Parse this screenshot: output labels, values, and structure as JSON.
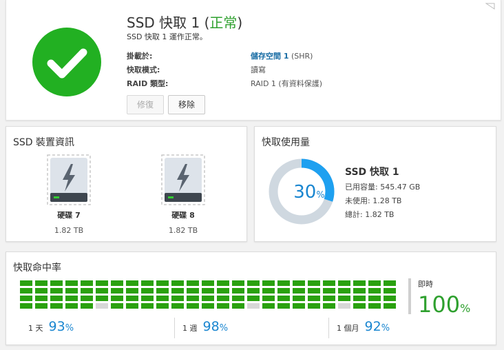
{
  "header": {
    "title_prefix": "SSD 快取 1 (",
    "title_status": "正常",
    "title_suffix": ")",
    "subtitle": "SSD 快取 1 運作正常。",
    "status_color": "#22b022"
  },
  "info": {
    "mount_label": "掛載於:",
    "mount_value_bold": "儲存空間 1",
    "mount_value_rest": " (SHR)",
    "mode_label": "快取模式:",
    "mode_value": "讀寫",
    "raid_label": "RAID 類型:",
    "raid_value": "RAID 1 (有資料保護)"
  },
  "buttons": {
    "repair": "修復",
    "remove": "移除"
  },
  "device_info": {
    "title": "SSD 裝置資訊",
    "drives": [
      {
        "name": "硬碟 7",
        "size": "1.82 TB"
      },
      {
        "name": "硬碟 8",
        "size": "1.82 TB"
      }
    ]
  },
  "cache_usage": {
    "title": "快取使用量",
    "percent": "30",
    "percent_sign": "%",
    "percent_value": 30,
    "cache_name": "SSD 快取 1",
    "used": "已用容量: 545.47 GB",
    "unused": "未使用: 1.28 TB",
    "total": "總計: 1.82 TB",
    "ring_color": "#1ea0f0",
    "ring_bg_color": "#cfd8e0"
  },
  "hit_rate": {
    "title": "快取命中率",
    "realtime_label": "即時",
    "realtime_value": "100",
    "realtime_sign": "%",
    "day_label": "1 天",
    "day_value": "93",
    "week_label": "1 週",
    "week_value": "98",
    "month_label": "1 個月",
    "month_value": "92",
    "sign": "%",
    "hit_color": "#2aa10f",
    "miss_color": "#d7d7d7",
    "columns": [
      4,
      4,
      4,
      4,
      4,
      3,
      4,
      4,
      4,
      4,
      4,
      4,
      4,
      4,
      4,
      3,
      4,
      4,
      4,
      4,
      4,
      3,
      4,
      4,
      4
    ]
  }
}
